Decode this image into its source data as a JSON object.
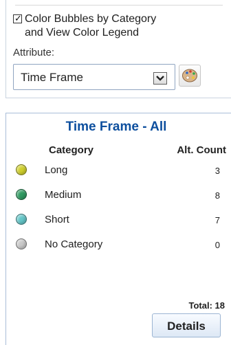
{
  "options": {
    "checkbox_checked": true,
    "checkbox_label_line1": "Color Bubbles by Category",
    "checkbox_label_line2": "and View Color Legend",
    "attribute_label": "Attribute:",
    "attribute_selected": "Time Frame",
    "dropdown_icon": "chevron-down-icon",
    "palette_icon": "palette-icon"
  },
  "legend": {
    "title": "Time Frame - All",
    "category_header": "Category",
    "count_header": "Alt. Count",
    "items": [
      {
        "name": "Long",
        "count": "3",
        "color": "#cfcf2c"
      },
      {
        "name": "Medium",
        "count": "8",
        "color": "#2f9a61"
      },
      {
        "name": "Short",
        "count": "7",
        "color": "#64c6c8"
      },
      {
        "name": "No Category",
        "count": "0",
        "color": "#c8c8c8"
      }
    ],
    "total_label": "Total:",
    "total_value": "18",
    "details_button": "Details"
  }
}
